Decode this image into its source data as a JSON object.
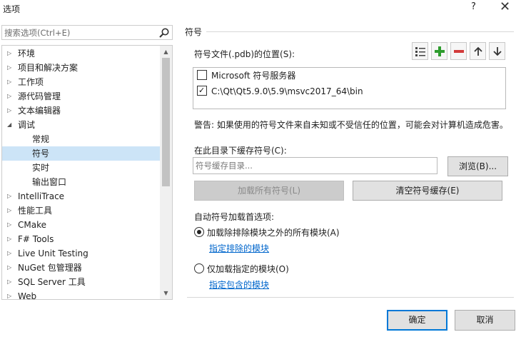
{
  "window": {
    "title": "选项",
    "help_glyph": "?",
    "close_glyph": "✕"
  },
  "search": {
    "placeholder": "搜索选项(Ctrl+E)"
  },
  "tree": {
    "items": [
      {
        "label": "环境",
        "expandable": true,
        "selected": false
      },
      {
        "label": "项目和解决方案",
        "expandable": true,
        "selected": false
      },
      {
        "label": "工作项",
        "expandable": true,
        "selected": false
      },
      {
        "label": "源代码管理",
        "expandable": true,
        "selected": false
      },
      {
        "label": "文本编辑器",
        "expandable": true,
        "selected": false
      },
      {
        "label": "调试",
        "expandable": true,
        "expanded": true,
        "selected": false
      },
      {
        "label": "常规",
        "child": true,
        "selected": false
      },
      {
        "label": "符号",
        "child": true,
        "selected": true
      },
      {
        "label": "实时",
        "child": true,
        "selected": false
      },
      {
        "label": "输出窗口",
        "child": true,
        "selected": false
      },
      {
        "label": "IntelliTrace",
        "expandable": true,
        "selected": false
      },
      {
        "label": "性能工具",
        "expandable": true,
        "selected": false
      },
      {
        "label": "CMake",
        "expandable": true,
        "selected": false
      },
      {
        "label": "F# Tools",
        "expandable": true,
        "selected": false
      },
      {
        "label": "Live Unit Testing",
        "expandable": true,
        "selected": false
      },
      {
        "label": "NuGet 包管理器",
        "expandable": true,
        "selected": false
      },
      {
        "label": "SQL Server 工具",
        "expandable": true,
        "selected": false
      },
      {
        "label": "Web",
        "expandable": true,
        "selected": false
      }
    ]
  },
  "symbols": {
    "section_title": "符号",
    "pdb_label": "符号文件(.pdb)的位置(S):",
    "locations": [
      {
        "label": "Microsoft 符号服务器",
        "checked": false
      },
      {
        "label": "C:\\Qt\\Qt5.9.0\\5.9\\msvc2017_64\\bin",
        "checked": true
      }
    ],
    "warning": "警告: 如果使用的符号文件来自未知或不受信任的位置，可能会对计算机造成危害。",
    "cache_label": "在此目录下缓存符号(C):",
    "cache_placeholder": "符号缓存目录...",
    "browse_label": "浏览(B)...",
    "load_all_label": "加载所有符号(L)",
    "clear_cache_label": "清空符号缓存(E)",
    "auto_load_label": "自动符号加载首选项:",
    "option_all": "加载除排除模块之外的所有模块(A)",
    "link_exclude": "指定排除的模块",
    "option_specified": "仅加载指定的模块(O)",
    "link_include": "指定包含的模块",
    "selected_option": "all"
  },
  "dialog": {
    "ok_label": "确定",
    "cancel_label": "取消"
  },
  "colors": {
    "selection": "#cce4f7",
    "link": "#0066cc",
    "add_green": "#2e9c2e",
    "remove_red": "#d23b3b",
    "accent": "#0078d7"
  }
}
